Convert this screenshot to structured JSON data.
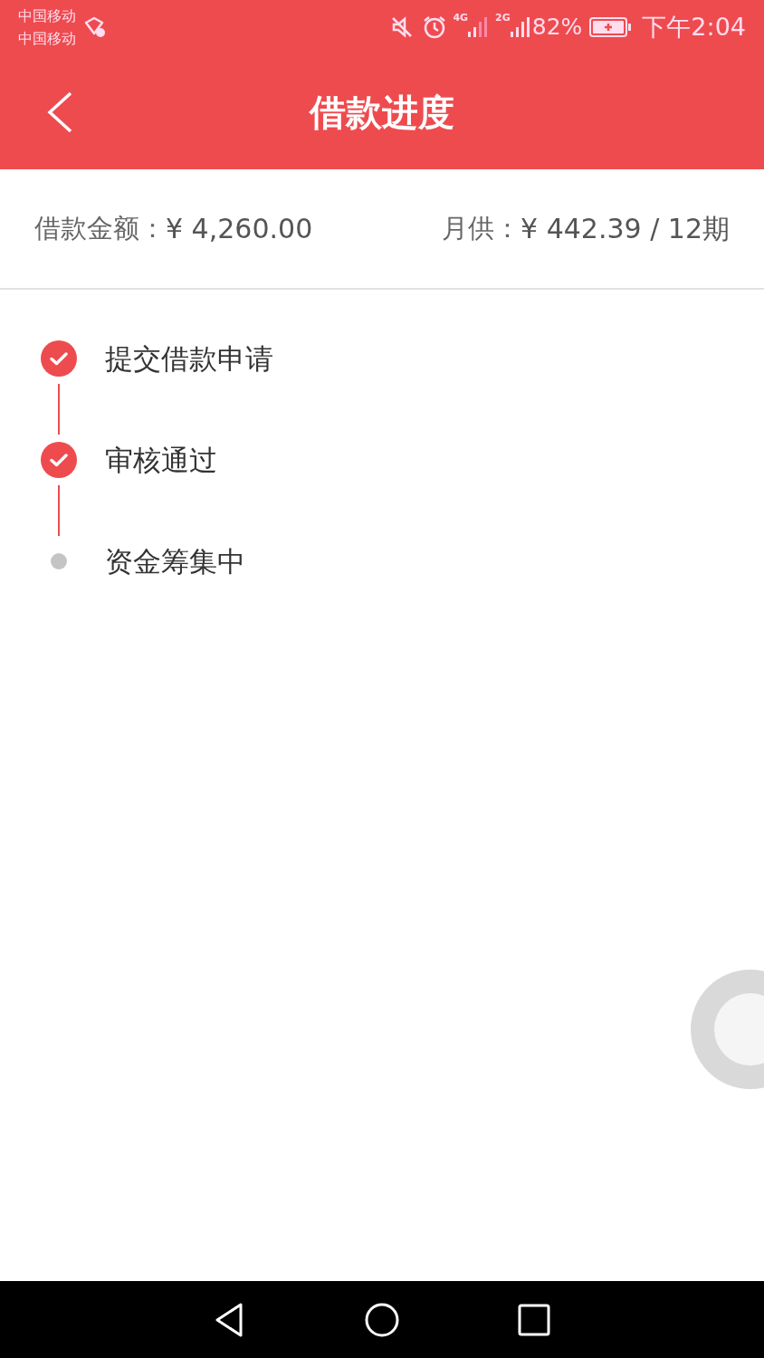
{
  "status_bar": {
    "carriers": [
      "中国移动",
      "中国移动"
    ],
    "network_1": "4G",
    "network_2": "2G",
    "battery": "82%",
    "time": "下午2:04"
  },
  "header": {
    "title": "借款进度"
  },
  "summary": {
    "amount_label": "借款金额：",
    "amount": "¥ 4,260.00",
    "monthly_label": "月供：",
    "monthly": "¥ 442.39 / 12期"
  },
  "steps": [
    {
      "label": "提交借款申请",
      "done": true
    },
    {
      "label": "审核通过",
      "done": true
    },
    {
      "label": "资金筹集中",
      "done": false
    }
  ]
}
